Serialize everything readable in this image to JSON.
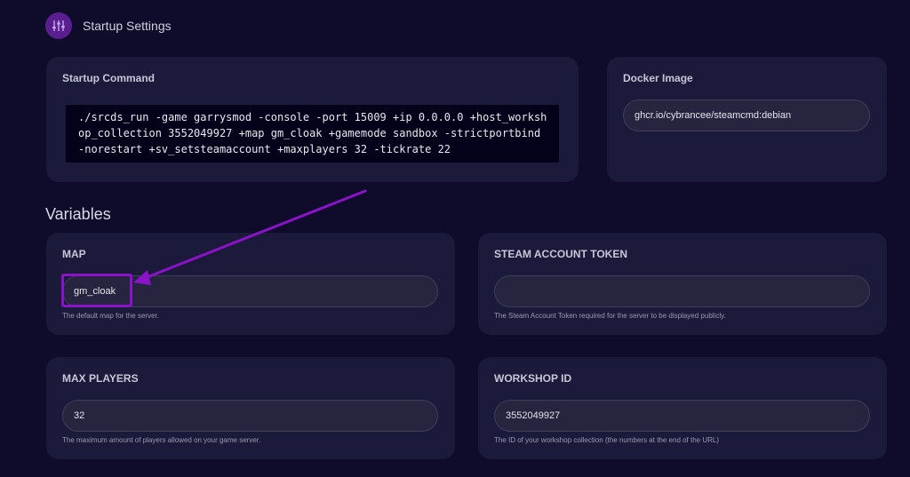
{
  "header": {
    "title": "Startup Settings",
    "icon": "sliders-icon"
  },
  "startup": {
    "title": "Startup Command",
    "command": "./srcds_run -game garrysmod -console -port 15009 +ip 0.0.0.0 +host_workshop_collection 3552049927 +map gm_cloak +gamemode sandbox -strictportbind -norestart +sv_setsteamaccount +maxplayers 32 -tickrate 22"
  },
  "docker": {
    "title": "Docker Image",
    "value": "ghcr.io/cybrancee/steamcmd:debian"
  },
  "variables_title": "Variables",
  "variables": {
    "map": {
      "label": "MAP",
      "value": "gm_cloak",
      "help": "The default map for the server."
    },
    "steam_token": {
      "label": "STEAM ACCOUNT TOKEN",
      "value": "",
      "help": "The Steam Account Token required for the server to be displayed publicly."
    },
    "max_players": {
      "label": "MAX PLAYERS",
      "value": "32",
      "help": "The maximum amount of players allowed on your game server."
    },
    "workshop_id": {
      "label": "WORKSHOP ID",
      "value": "3552049927",
      "help": "The ID of your workshop collection (the numbers at the end of the URL)"
    }
  },
  "colors": {
    "accent": "#8a12c8",
    "background": "#0e0c2a",
    "card": "#1c1a3a"
  }
}
